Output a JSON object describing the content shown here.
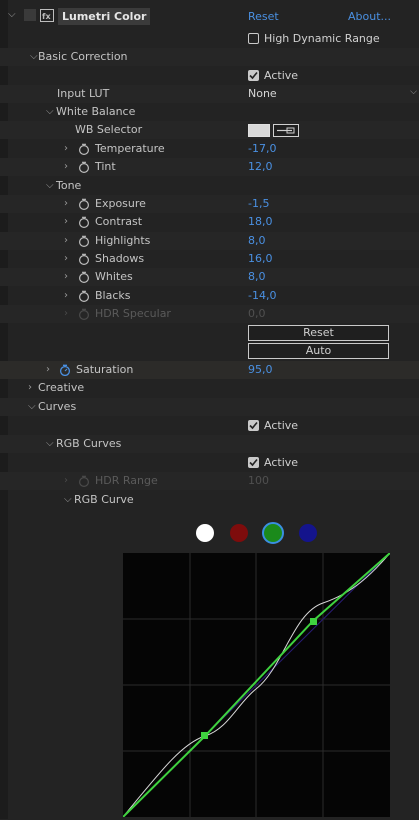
{
  "header": {
    "effect_name": "Lumetri Color",
    "reset": "Reset",
    "about": "About..."
  },
  "hdr": {
    "label": "High Dynamic Range"
  },
  "basic": {
    "title": "Basic Correction",
    "active": "Active",
    "input_lut_label": "Input LUT",
    "input_lut_value": "None",
    "white_balance": "White Balance",
    "wb_selector": "WB Selector",
    "temperature": {
      "label": "Temperature",
      "value": "-17,0"
    },
    "tint": {
      "label": "Tint",
      "value": "12,0"
    },
    "tone": "Tone",
    "exposure": {
      "label": "Exposure",
      "value": "-1,5"
    },
    "contrast": {
      "label": "Contrast",
      "value": "18,0"
    },
    "highlights": {
      "label": "Highlights",
      "value": "8,0"
    },
    "shadows": {
      "label": "Shadows",
      "value": "16,0"
    },
    "whites": {
      "label": "Whites",
      "value": "8,0"
    },
    "blacks": {
      "label": "Blacks",
      "value": "-14,0"
    },
    "hdr_specular": {
      "label": "HDR Specular",
      "value": "0,0"
    },
    "reset_button": "Reset",
    "auto_button": "Auto",
    "saturation": {
      "label": "Saturation",
      "value": "95,0"
    }
  },
  "creative": {
    "title": "Creative"
  },
  "curves": {
    "title": "Curves",
    "active": "Active",
    "rgb_curves": "RGB Curves",
    "rgb_active": "Active",
    "hdr_range": {
      "label": "HDR Range",
      "value": "100"
    },
    "rgb_curve": "RGB Curve"
  },
  "channels": [
    {
      "name": "white",
      "color": "#ffffff"
    },
    {
      "name": "red",
      "color": "#8b0f0f"
    },
    {
      "name": "green",
      "color": "#1e8b1e"
    },
    {
      "name": "blue",
      "color": "#1a1a8b"
    }
  ],
  "colors": {
    "accent": "#4a90e2",
    "green_curve": "#3fd23f"
  }
}
